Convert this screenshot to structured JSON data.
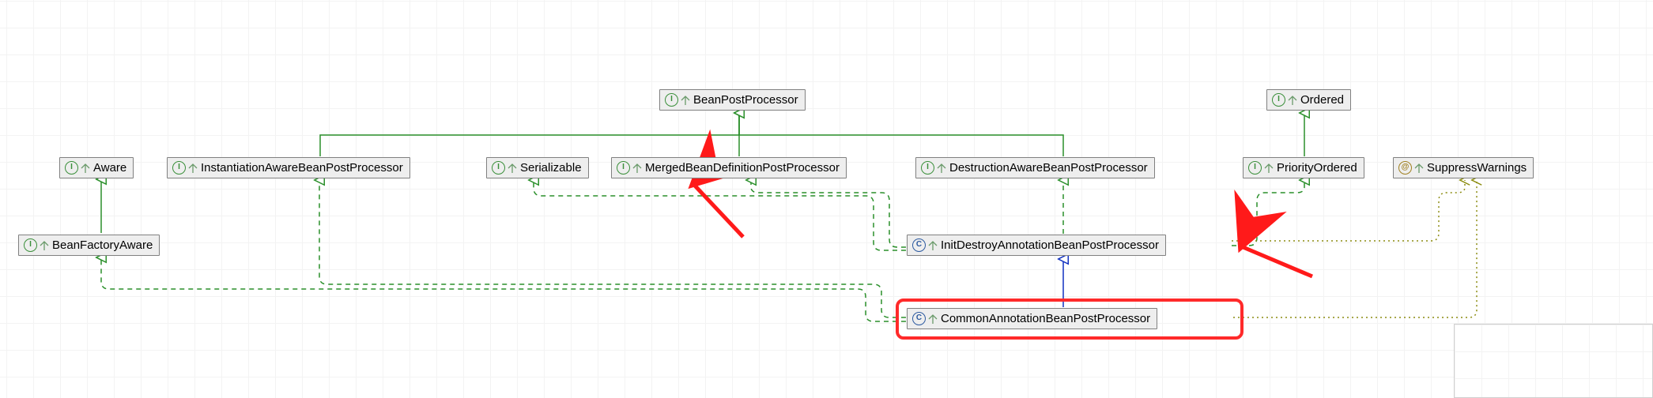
{
  "nodes": {
    "aware": {
      "label": "Aware",
      "kind": "interface"
    },
    "bpp": {
      "label": "BeanPostProcessor",
      "kind": "interface"
    },
    "ordered": {
      "label": "Ordered",
      "kind": "interface"
    },
    "instAware": {
      "label": "InstantiationAwareBeanPostProcessor",
      "kind": "interface"
    },
    "serializable": {
      "label": "Serializable",
      "kind": "interface"
    },
    "merged": {
      "label": "MergedBeanDefinitionPostProcessor",
      "kind": "interface"
    },
    "destruction": {
      "label": "DestructionAwareBeanPostProcessor",
      "kind": "interface"
    },
    "priority": {
      "label": "PriorityOrdered",
      "kind": "interface"
    },
    "suppress": {
      "label": "SuppressWarnings",
      "kind": "annotation"
    },
    "bfa": {
      "label": "BeanFactoryAware",
      "kind": "interface"
    },
    "initDestroy": {
      "label": "InitDestroyAnnotationBeanPostProcessor",
      "kind": "class"
    },
    "common": {
      "label": "CommonAnnotationBeanPostProcessor",
      "kind": "class"
    }
  },
  "edges": [
    {
      "from": "bfa",
      "to": "aware",
      "style": "solid-green"
    },
    {
      "from": "instAware",
      "to": "bpp",
      "style": "solid-green"
    },
    {
      "from": "merged",
      "to": "bpp",
      "style": "solid-green"
    },
    {
      "from": "destruction",
      "to": "bpp",
      "style": "solid-green"
    },
    {
      "from": "priority",
      "to": "ordered",
      "style": "solid-green"
    },
    {
      "from": "initDestroy",
      "to": "serializable",
      "style": "dashed-green"
    },
    {
      "from": "initDestroy",
      "to": "merged",
      "style": "dashed-green"
    },
    {
      "from": "initDestroy",
      "to": "destruction",
      "style": "dashed-green"
    },
    {
      "from": "initDestroy",
      "to": "priority",
      "style": "dashed-green"
    },
    {
      "from": "common",
      "to": "bfa",
      "style": "dashed-green"
    },
    {
      "from": "common",
      "to": "instAware",
      "style": "dashed-green"
    },
    {
      "from": "common",
      "to": "initDestroy",
      "style": "solid-blue"
    },
    {
      "from": "initDestroy",
      "to": "suppress",
      "style": "dotted-olive"
    },
    {
      "from": "common",
      "to": "suppress",
      "style": "dotted-olive"
    }
  ],
  "callouts": [
    {
      "target": "merged",
      "style": "red-arrow"
    },
    {
      "target": "initDestroy",
      "style": "red-arrow"
    }
  ],
  "highlight": "common",
  "kinds": {
    "interface": {
      "letter": "I",
      "color": "#3a8f3a"
    },
    "class": {
      "letter": "C",
      "color": "#2c5aa0"
    },
    "annotation": {
      "letter": "@",
      "color": "#a08020"
    }
  },
  "chart_data": {
    "type": "uml-class-hierarchy",
    "title": "",
    "nodes": [
      "Aware",
      "BeanPostProcessor",
      "Ordered",
      "InstantiationAwareBeanPostProcessor",
      "Serializable",
      "MergedBeanDefinitionPostProcessor",
      "DestructionAwareBeanPostProcessor",
      "PriorityOrdered",
      "SuppressWarnings",
      "BeanFactoryAware",
      "InitDestroyAnnotationBeanPostProcessor",
      "CommonAnnotationBeanPostProcessor"
    ],
    "relations": [
      [
        "BeanFactoryAware",
        "extends",
        "Aware"
      ],
      [
        "InstantiationAwareBeanPostProcessor",
        "extends",
        "BeanPostProcessor"
      ],
      [
        "MergedBeanDefinitionPostProcessor",
        "extends",
        "BeanPostProcessor"
      ],
      [
        "DestructionAwareBeanPostProcessor",
        "extends",
        "BeanPostProcessor"
      ],
      [
        "PriorityOrdered",
        "extends",
        "Ordered"
      ],
      [
        "InitDestroyAnnotationBeanPostProcessor",
        "implements",
        "Serializable"
      ],
      [
        "InitDestroyAnnotationBeanPostProcessor",
        "implements",
        "MergedBeanDefinitionPostProcessor"
      ],
      [
        "InitDestroyAnnotationBeanPostProcessor",
        "implements",
        "DestructionAwareBeanPostProcessor"
      ],
      [
        "InitDestroyAnnotationBeanPostProcessor",
        "implements",
        "PriorityOrdered"
      ],
      [
        "InitDestroyAnnotationBeanPostProcessor",
        "annotated-with",
        "SuppressWarnings"
      ],
      [
        "CommonAnnotationBeanPostProcessor",
        "implements",
        "BeanFactoryAware"
      ],
      [
        "CommonAnnotationBeanPostProcessor",
        "implements",
        "InstantiationAwareBeanPostProcessor"
      ],
      [
        "CommonAnnotationBeanPostProcessor",
        "extends",
        "InitDestroyAnnotationBeanPostProcessor"
      ],
      [
        "CommonAnnotationBeanPostProcessor",
        "annotated-with",
        "SuppressWarnings"
      ]
    ],
    "selected": "CommonAnnotationBeanPostProcessor",
    "callouts": [
      "MergedBeanDefinitionPostProcessor",
      "InitDestroyAnnotationBeanPostProcessor"
    ]
  }
}
